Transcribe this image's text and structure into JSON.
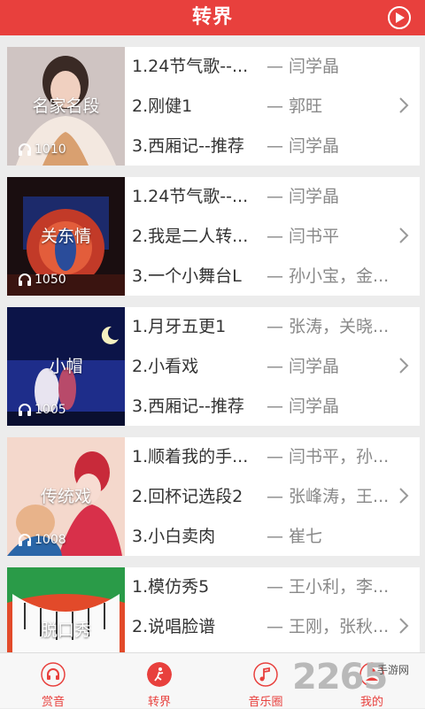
{
  "header": {
    "title": "转界"
  },
  "cards": [
    {
      "category": "名家名段",
      "plays": "1010",
      "songs": [
        {
          "name": "1.24节气歌--...",
          "artist": "— 闫学晶"
        },
        {
          "name": "2.刚健1",
          "artist": "— 郭旺"
        },
        {
          "name": "3.西厢记--推荐",
          "artist": "— 闫学晶"
        }
      ]
    },
    {
      "category": "关东情",
      "plays": "1050",
      "songs": [
        {
          "name": "1.24节气歌--...",
          "artist": "— 闫学晶"
        },
        {
          "name": "2.我是二人转...",
          "artist": "— 闫书平"
        },
        {
          "name": "3.一个小舞台L",
          "artist": "— 孙小宝，金..."
        }
      ]
    },
    {
      "category": "小帽",
      "plays": "1005",
      "songs": [
        {
          "name": "1.月牙五更1",
          "artist": "— 张涛，关晓..."
        },
        {
          "name": "2.小看戏",
          "artist": "— 闫学晶"
        },
        {
          "name": "3.西厢记--推荐",
          "artist": "— 闫学晶"
        }
      ]
    },
    {
      "category": "传统戏",
      "plays": "1008",
      "songs": [
        {
          "name": "1.顺着我的手...",
          "artist": "— 闫书平，孙..."
        },
        {
          "name": "2.回杯记选段2",
          "artist": "— 张峰涛，王..."
        },
        {
          "name": "3.小白卖肉",
          "artist": "— 崔七"
        }
      ]
    },
    {
      "category": "脱口秀",
      "plays": "",
      "songs": [
        {
          "name": "1.模仿秀5",
          "artist": "— 王小利，李..."
        },
        {
          "name": "2.说唱脸谱",
          "artist": "— 王刚，张秋..."
        }
      ]
    }
  ],
  "tabs": [
    {
      "label": "赏音",
      "icon": "headphones-icon"
    },
    {
      "label": "转界",
      "icon": "dancer-icon"
    },
    {
      "label": "音乐圈",
      "icon": "music-note-icon"
    },
    {
      "label": "我的",
      "icon": "user-icon"
    }
  ],
  "watermark": {
    "number": "2265",
    "text": "手游网"
  },
  "colors": {
    "accent": "#e8403d"
  }
}
